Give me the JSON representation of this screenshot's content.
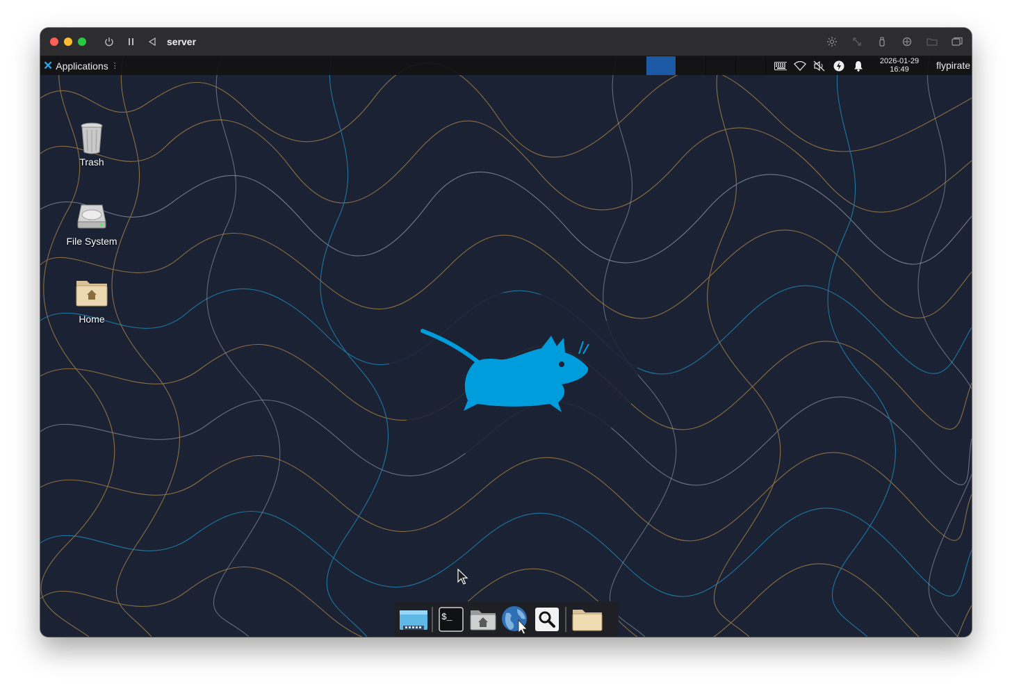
{
  "vm": {
    "title": "server",
    "toolbar_icons": [
      "power-icon",
      "pause-icon",
      "back-icon",
      "brightness-icon",
      "resize-icon",
      "usb-icon",
      "share-icon",
      "folder-icon",
      "windows-icon"
    ]
  },
  "panel": {
    "applications_label": "Applications",
    "workspaces": [
      {
        "active": true
      },
      {
        "active": false
      },
      {
        "active": false
      },
      {
        "active": false
      }
    ],
    "tray_icons": [
      "keyboard-icon",
      "wifi-icon",
      "volume-muted-icon",
      "power-manager-icon",
      "notification-bell-icon"
    ],
    "date": "2026-01-29",
    "time": "16:49",
    "user": "flypirate"
  },
  "desktop": {
    "icons": [
      {
        "label": "Trash",
        "icon": "trash-icon"
      },
      {
        "label": "File System",
        "icon": "drive-icon"
      },
      {
        "label": "Home",
        "icon": "home-folder-icon"
      }
    ]
  },
  "dock": {
    "items": [
      "show-desktop-icon",
      "terminal-icon",
      "home-folder-icon",
      "web-browser-icon",
      "app-finder-icon",
      "files-icon"
    ]
  },
  "colors": {
    "panel_bg": "#121214",
    "workspace_active": "#1d5aa6",
    "wallpaper_bg": "#1b2234",
    "logo_blue": "#009ddc",
    "contour_gold": "#a07d45",
    "contour_blue": "#1f86b8",
    "contour_white": "#c8cdd8"
  }
}
